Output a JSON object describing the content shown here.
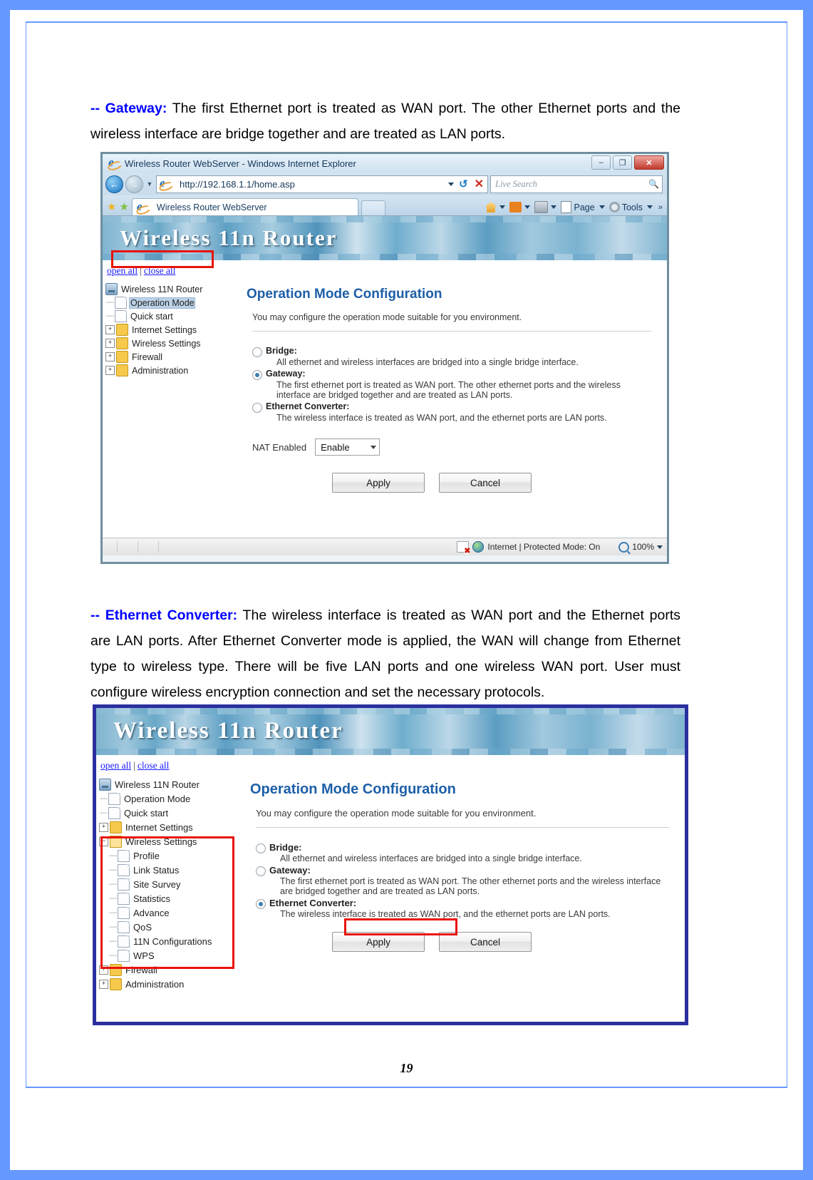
{
  "document": {
    "page_number": "19",
    "paragraphs": [
      {
        "lead": "-- Gateway:",
        "text": " The first Ethernet port is treated as WAN port. The other Ethernet ports and the wireless interface are bridge together and are treated as LAN ports."
      },
      {
        "lead": "-- Ethernet Converter:",
        "text": " The wireless interface is treated as WAN port and the Ethernet ports are LAN ports. After Ethernet Converter mode is applied, the WAN will change from Ethernet type to wireless type. There will be five LAN ports and one wireless WAN port. User must configure wireless encryption connection and set the necessary protocols."
      }
    ]
  },
  "browser": {
    "window_title": "Wireless Router WebServer - Windows Internet Explorer",
    "window_buttons": {
      "minimize": "–",
      "maximize": "❐",
      "close": "✕"
    },
    "address_url": "http://192.168.1.1/home.asp",
    "search_placeholder": "Live Search",
    "tab_title": "Wireless Router WebServer",
    "command_bar": {
      "page_label": "Page",
      "tools_label": "Tools",
      "overflow": "»"
    },
    "status_bar": {
      "zone_text": "Internet | Protected Mode: On",
      "zoom_level": "100%"
    }
  },
  "router_ui": {
    "banner_title": "Wireless 11n Router",
    "open_all": "open all",
    "close_all": "close all",
    "separator": "|",
    "page_heading": "Operation Mode Configuration",
    "intro_text": "You may configure the operation mode suitable for you environment.",
    "nat_label": "NAT Enabled",
    "nat_value": "Enable",
    "apply_label": "Apply",
    "cancel_label": "Cancel",
    "modes": [
      {
        "label": "Bridge:",
        "description": "All ethernet and wireless interfaces are bridged into a single bridge interface."
      },
      {
        "label": "Gateway:",
        "description": "The first ethernet port is treated as WAN port. The other ethernet ports and the wireless interface are bridged together and are treated as LAN ports."
      },
      {
        "label": "Ethernet Converter:",
        "description": "The wireless interface is treated as WAN port, and the ethernet ports are LAN ports."
      }
    ],
    "tree_shot1": [
      {
        "label": "Wireless 11N Router",
        "icon": "computer-icon",
        "expander": "none",
        "level": 0
      },
      {
        "label": "Operation Mode",
        "icon": "page-icon",
        "expander": "dash",
        "level": 1,
        "selected": true
      },
      {
        "label": "Quick start",
        "icon": "page-icon",
        "expander": "dash",
        "level": 1
      },
      {
        "label": "Internet Settings",
        "icon": "folder-icon",
        "expander": "plus",
        "level": 1
      },
      {
        "label": "Wireless Settings",
        "icon": "folder-icon",
        "expander": "plus",
        "level": 1
      },
      {
        "label": "Firewall",
        "icon": "folder-icon",
        "expander": "plus",
        "level": 1
      },
      {
        "label": "Administration",
        "icon": "folder-icon",
        "expander": "plus",
        "level": 1
      }
    ],
    "tree_shot2": [
      {
        "label": "Wireless 11N Router",
        "icon": "computer-icon",
        "expander": "none",
        "level": 0
      },
      {
        "label": "Operation Mode",
        "icon": "page-icon",
        "expander": "dash",
        "level": 1
      },
      {
        "label": "Quick start",
        "icon": "page-icon",
        "expander": "dash",
        "level": 1
      },
      {
        "label": "Internet Settings",
        "icon": "folder-icon",
        "expander": "plus",
        "level": 1
      },
      {
        "label": "Wireless Settings",
        "icon": "folder-open-icon",
        "expander": "minus",
        "level": 1
      },
      {
        "label": "Profile",
        "icon": "page-icon",
        "expander": "dash",
        "level": 2
      },
      {
        "label": "Link Status",
        "icon": "page-icon",
        "expander": "dash",
        "level": 2
      },
      {
        "label": "Site Survey",
        "icon": "page-icon",
        "expander": "dash",
        "level": 2
      },
      {
        "label": "Statistics",
        "icon": "page-icon",
        "expander": "dash",
        "level": 2
      },
      {
        "label": "Advance",
        "icon": "page-icon",
        "expander": "dash",
        "level": 2
      },
      {
        "label": "QoS",
        "icon": "page-icon",
        "expander": "dash",
        "level": 2
      },
      {
        "label": "11N Configurations",
        "icon": "page-icon",
        "expander": "dash",
        "level": 2
      },
      {
        "label": "WPS",
        "icon": "page-icon",
        "expander": "dash",
        "level": 2
      },
      {
        "label": "Firewall",
        "icon": "folder-icon",
        "expander": "plus",
        "level": 1
      },
      {
        "label": "Administration",
        "icon": "folder-icon",
        "expander": "plus",
        "level": 1
      }
    ]
  },
  "colors": {
    "page_border": "#6699ff",
    "lead_text": "#0000ff",
    "heading": "#1d5fa8",
    "highlight_box": "#e8130b",
    "shot2_border": "#2b2f9e"
  }
}
